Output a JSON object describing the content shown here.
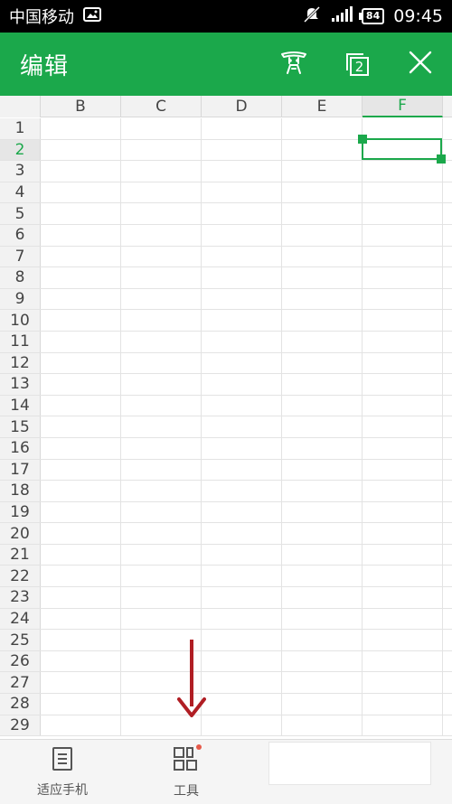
{
  "status_bar": {
    "carrier": "中国移动",
    "battery": "84",
    "time": "09:45",
    "icons": [
      "image-icon",
      "mute-icon",
      "signal-icon",
      "battery-icon"
    ]
  },
  "app_bar": {
    "title": "编辑",
    "actions": [
      "clean-icon",
      "window-count-icon",
      "close-icon"
    ],
    "window_count": "2",
    "background": "#1ba84b"
  },
  "sheet": {
    "columns": [
      "B",
      "C",
      "D",
      "E",
      "F"
    ],
    "active_column": "F",
    "rows": [
      "1",
      "2",
      "3",
      "4",
      "5",
      "6",
      "7",
      "8",
      "9",
      "10",
      "11",
      "12",
      "13",
      "14",
      "15",
      "16",
      "17",
      "18",
      "19",
      "20",
      "21",
      "22",
      "23",
      "24",
      "25",
      "26",
      "27",
      "28",
      "29"
    ],
    "active_row": "2",
    "accent": "#1ba84b"
  },
  "bottom_bar": {
    "fit_phone_label": "适应手机",
    "tools_label": "工具",
    "badge_color": "#e65a4a"
  },
  "annotation_arrow_color": "#b01e24"
}
